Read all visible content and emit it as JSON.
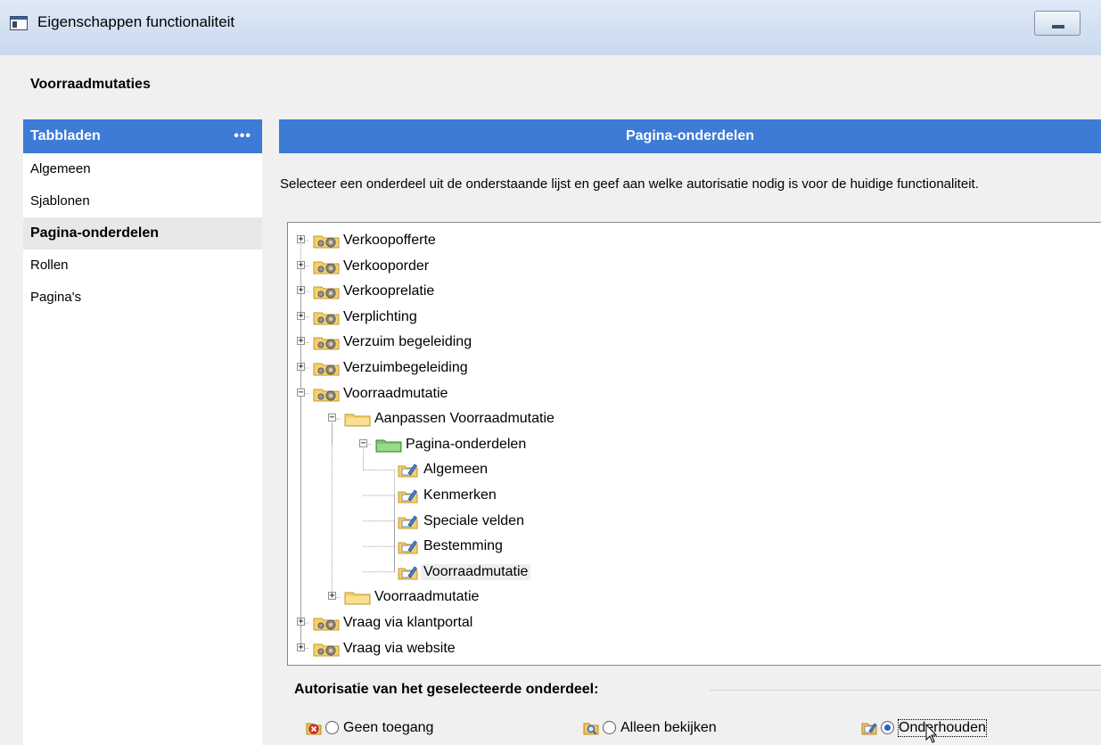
{
  "window": {
    "title": "Eigenschappen functionaliteit"
  },
  "header": {
    "title": "Voorraadmutaties"
  },
  "sidebar": {
    "title": "Tabbladen",
    "more_label": "•••",
    "items": [
      {
        "label": "Algemeen",
        "active": false
      },
      {
        "label": "Sjablonen",
        "active": false
      },
      {
        "label": "Pagina-onderdelen",
        "active": true
      },
      {
        "label": "Rollen",
        "active": false
      },
      {
        "label": "Pagina's",
        "active": false
      }
    ]
  },
  "main": {
    "title": "Pagina-onderdelen",
    "instruction": "Selecteer een onderdeel uit de onderstaande lijst en geef aan welke autorisatie nodig is voor de huidige functionaliteit."
  },
  "tree": {
    "nodes": [
      {
        "label": "Verkoopofferte",
        "level": 0,
        "expander": "+",
        "icon": "folder-gear-icon"
      },
      {
        "label": "Verkooporder",
        "level": 0,
        "expander": "+",
        "icon": "folder-gear-icon"
      },
      {
        "label": "Verkooprelatie",
        "level": 0,
        "expander": "+",
        "icon": "folder-gear-icon"
      },
      {
        "label": "Verplichting",
        "level": 0,
        "expander": "+",
        "icon": "folder-gear-icon"
      },
      {
        "label": "Verzuim begeleiding",
        "level": 0,
        "expander": "+",
        "icon": "folder-gear-icon"
      },
      {
        "label": "Verzuimbegeleiding",
        "level": 0,
        "expander": "+",
        "icon": "folder-gear-icon"
      },
      {
        "label": "Voorraadmutatie",
        "level": 0,
        "expander": "-",
        "icon": "folder-gear-icon"
      },
      {
        "label": "Aanpassen Voorraadmutatie",
        "level": 1,
        "expander": "-",
        "icon": "folder-icon"
      },
      {
        "label": "Pagina-onderdelen",
        "level": 2,
        "expander": "-",
        "icon": "green-folder-icon"
      },
      {
        "label": "Algemeen",
        "level": 3,
        "expander": "",
        "icon": "edit-page-icon"
      },
      {
        "label": "Kenmerken",
        "level": 3,
        "expander": "",
        "icon": "edit-page-icon"
      },
      {
        "label": "Speciale velden",
        "level": 3,
        "expander": "",
        "icon": "edit-page-icon"
      },
      {
        "label": "Bestemming",
        "level": 3,
        "expander": "",
        "icon": "edit-page-icon"
      },
      {
        "label": "Voorraadmutatie",
        "level": 3,
        "expander": "",
        "icon": "edit-page-icon",
        "selected": true
      },
      {
        "label": "Voorraadmutatie",
        "level": 1,
        "expander": "+",
        "icon": "folder-icon"
      },
      {
        "label": "Vraag via klantportal",
        "level": 0,
        "expander": "+",
        "icon": "folder-gear-icon"
      },
      {
        "label": "Vraag via website",
        "level": 0,
        "expander": "+",
        "icon": "folder-gear-icon"
      }
    ]
  },
  "authorization": {
    "title": "Autorisatie van het geselecteerde onderdeel:",
    "options": [
      {
        "label": "Geen toegang",
        "checked": false,
        "icon": "no-access-icon"
      },
      {
        "label": "Alleen bekijken",
        "checked": false,
        "icon": "view-icon"
      },
      {
        "label": "Onderhouden",
        "checked": true,
        "icon": "edit-icon"
      }
    ]
  }
}
